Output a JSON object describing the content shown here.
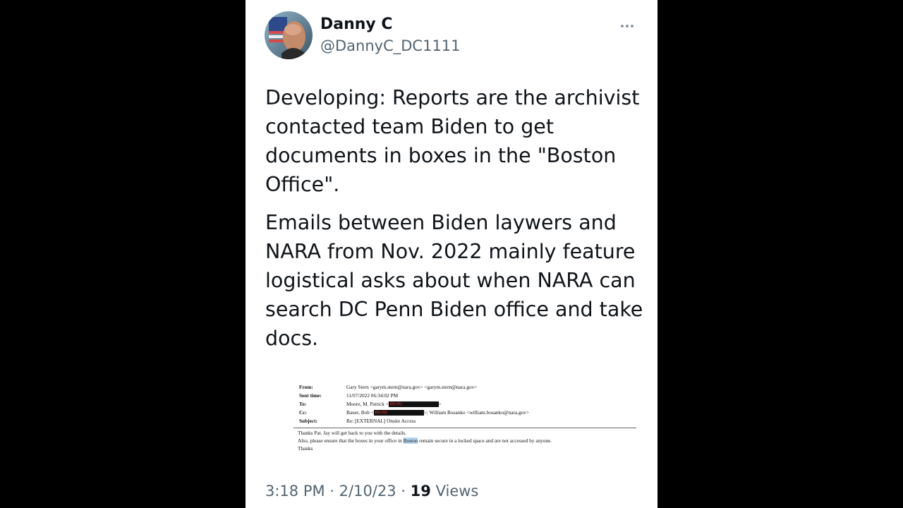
{
  "author": {
    "name": "Danny C",
    "handle": "@DannyC_DC1111",
    "avatar_icon": "profile-photo-icon"
  },
  "more_icon": "more-options-icon",
  "tweet": {
    "paragraph1": "Developing: Reports are the archivist contacted team Biden to get documents in boxes in the \"Boston Office\".",
    "paragraph2": "Emails between Biden laywers and NARA from Nov. 2022 mainly feature logistical asks about when NARA can search DC Penn Biden office and take docs."
  },
  "email": {
    "from_label": "From:",
    "from_value": "Gary Stern <garym.stern@nara.gov> <garym.stern@nara.gov>",
    "sent_label": "Sent time:",
    "sent_value": "11/07/2022 06:34:02 PM",
    "to_label": "To:",
    "to_value": "Moore, M. Patrick <",
    "to_redaction": "(b) (6)",
    "to_suffix": ">",
    "cc_label": "Cc:",
    "cc_value": "Bauer, Bob <",
    "cc_redaction": "(b) (6)",
    "cc_suffix": ">; William Bosanko <william.bosanko@nara.gov>",
    "subject_label": "Subject:",
    "subject_value": "Re: [EXTERNAL] Onsite Access",
    "body_line1": "Thanks Pat. Jay will get back to you with the details.",
    "body_line2_prefix": "Also, please ensure that the boxes in your office in ",
    "body_line2_highlight": "Boston",
    "body_line2_suffix": " remain secure in a locked space and are not accessed by anyone.",
    "body_line3": "Thanks"
  },
  "meta": {
    "time": "3:18 PM",
    "separator": " · ",
    "date": "2/10/23",
    "views_count": "19",
    "views_label": "Views"
  },
  "colors": {
    "background": "#000000",
    "card": "#ffffff",
    "text_primary": "#0f1419",
    "text_secondary": "#536471",
    "highlight": "#b9d6ee"
  }
}
